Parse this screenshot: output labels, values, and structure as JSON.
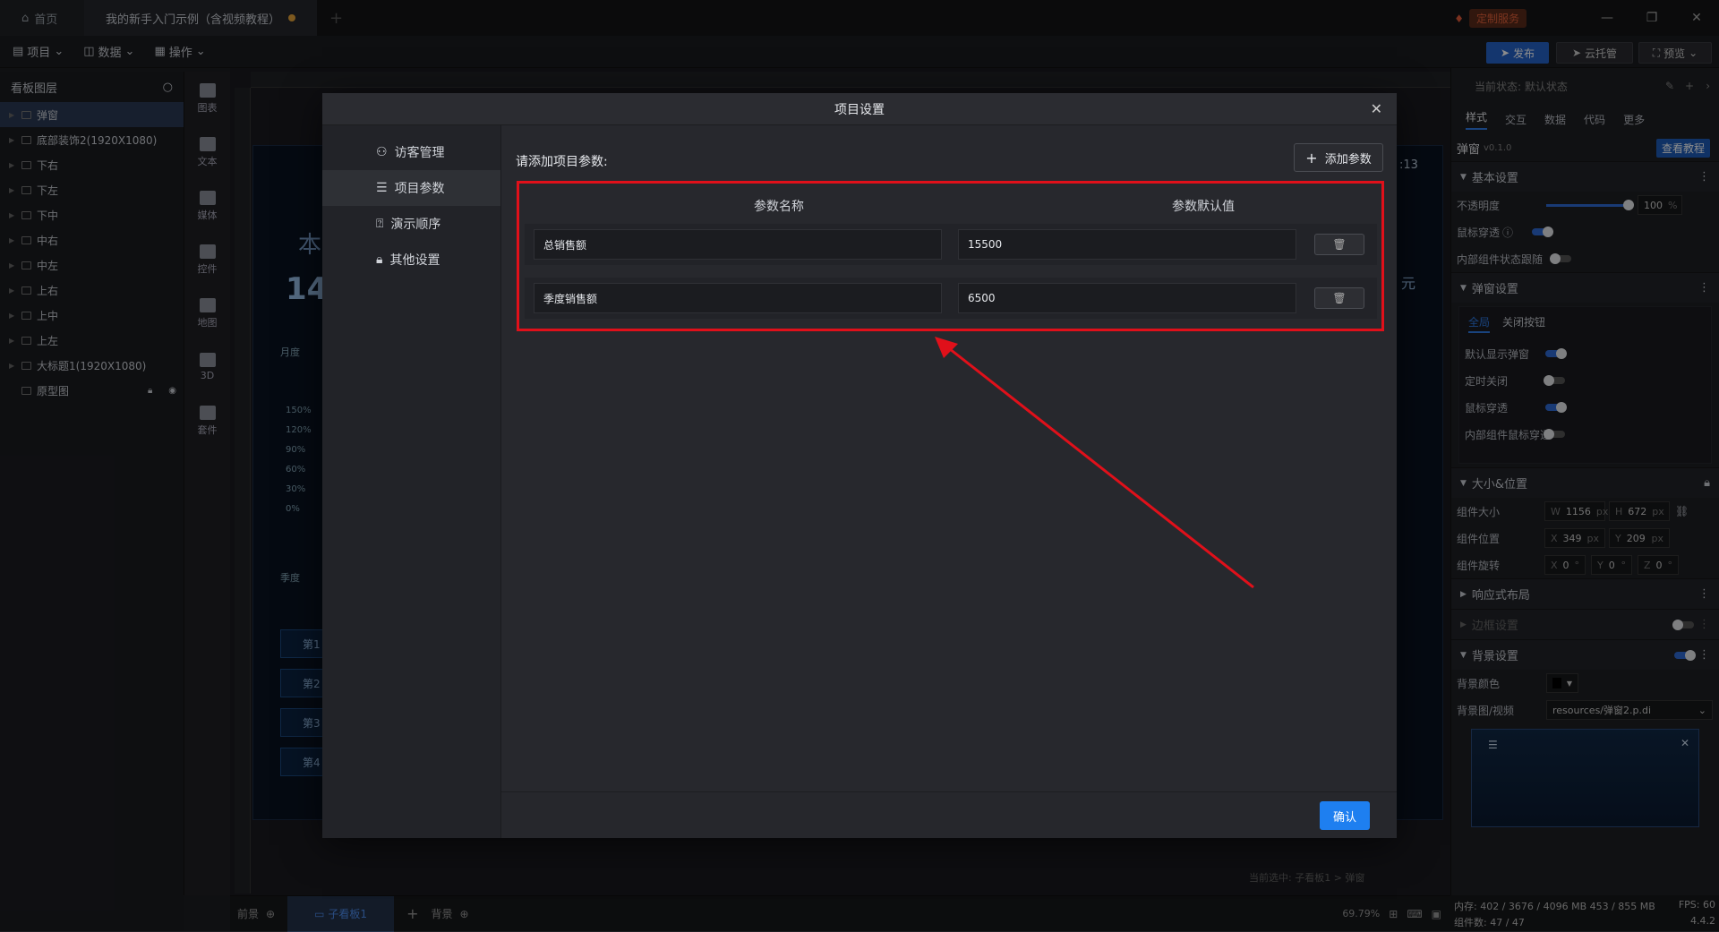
{
  "tabs": {
    "home": "首页",
    "doc": "我的新手入门示例（含视频教程）"
  },
  "service": "定制服务",
  "toolbar": {
    "project": "项目",
    "data": "数据",
    "operate": "操作",
    "publish": "发布",
    "cloud": "云托管",
    "preview": "预览"
  },
  "layers": {
    "title": "看板图层",
    "items": [
      "弹窗",
      "底部装饰2(1920X1080)",
      "下右",
      "下左",
      "下中",
      "中右",
      "中左",
      "上右",
      "上中",
      "上左",
      "大标题1(1920X1080)",
      "原型图"
    ]
  },
  "tools": [
    "图表",
    "文本",
    "媒体",
    "控件",
    "地图",
    "3D",
    "套件"
  ],
  "canvas": {
    "pcts": [
      "150%",
      "120%",
      "90%",
      "60%",
      "30%",
      "0%"
    ],
    "items": [
      "第1",
      "第2",
      "第3",
      "第4"
    ],
    "frag1": "本",
    "frag2": "14(",
    "time": ":13",
    "unit": "元",
    "month": "月度",
    "season": "季度",
    "status": "当前选中: 子看板1 > 弹窗"
  },
  "right": {
    "state": "当前状态: 默认状态",
    "tabs": [
      "样式",
      "交互",
      "数据",
      "代码",
      "更多"
    ],
    "comp": "弹窗",
    "ver": "v0.1.0",
    "tutorial": "查看教程",
    "basic": "基本设置",
    "opacity": "不透明度",
    "opacity_val": "100",
    "pct": "%",
    "mouse": "鼠标穿透",
    "inner_follow": "内部组件状态跟随",
    "popup": "弹窗设置",
    "sub_tabs": [
      "全局",
      "关闭按钮"
    ],
    "default_show": "默认显示弹窗",
    "timed_close": "定时关闭",
    "mouse2": "鼠标穿透",
    "inner_mouse": "内部组件鼠标穿透",
    "size_pos": "大小&位置",
    "size": "组件大小",
    "pos": "组件位置",
    "rot": "组件旋转",
    "w": "1156",
    "h": "672",
    "x": "349",
    "y": "209",
    "rx": "0",
    "ry": "0",
    "rz": "0",
    "l_w": "W",
    "l_h": "H",
    "l_x": "X",
    "l_y": "Y",
    "l_z": "Z",
    "px": "px",
    "deg": "°",
    "responsive": "响应式布局",
    "border": "边框设置",
    "bg": "背景设置",
    "bg_color": "背景颜色",
    "bg_media": "背景图/视频",
    "bg_file": "resources/弹窗2.p.di"
  },
  "status": {
    "front": "前景",
    "sub": "子看板1",
    "back": "背景",
    "zoom": "69.79%",
    "mem": "内存: 402 / 3676 / 4096 MB  453 / 855 MB",
    "fps": "FPS: 60",
    "count": "组件数: 47 / 47",
    "version": "4.4.2"
  },
  "modal": {
    "title": "项目设置",
    "nav": [
      "访客管理",
      "项目参数",
      "演示顺序",
      "其他设置"
    ],
    "prompt": "请添加项目参数:",
    "add": "添加参数",
    "col_name": "参数名称",
    "col_default": "参数默认值",
    "rows": [
      {
        "name": "总销售额",
        "value": "15500"
      },
      {
        "name": "季度销售额",
        "value": "6500"
      }
    ],
    "confirm": "确认"
  },
  "colors": {
    "accent": "#1e7ff0",
    "highlight": "#e0101a"
  }
}
